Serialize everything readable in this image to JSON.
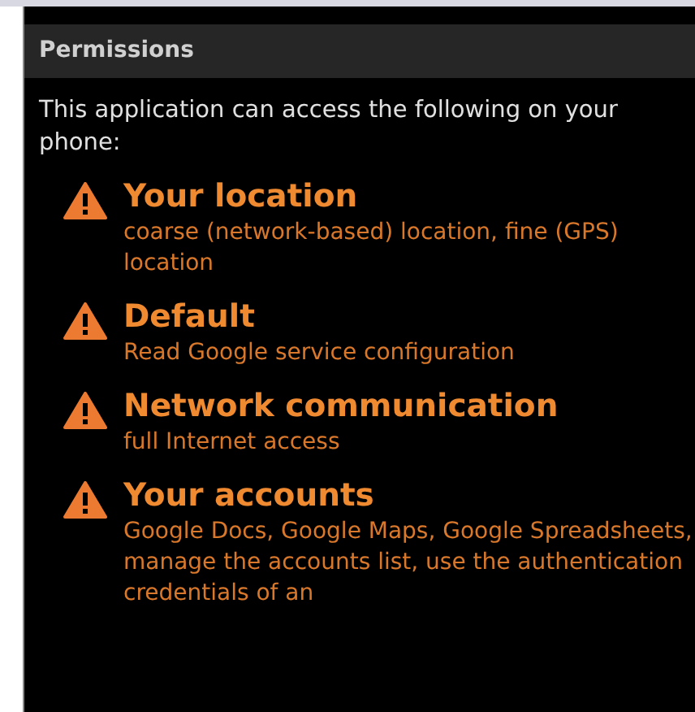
{
  "dialog": {
    "title": "Permissions",
    "intro": "This application can access the following on your phone:"
  },
  "permissions": [
    {
      "group": "Your location",
      "details": "coarse (network-based) location, fine (GPS) location"
    },
    {
      "group": "Default",
      "details": "Read Google service configuration"
    },
    {
      "group": "Network communication",
      "details": "full Internet access"
    },
    {
      "group": "Your accounts",
      "details": "Google Docs, Google Maps, Google Spreadsheets, manage the accounts list, use the authentication credentials of an"
    }
  ]
}
